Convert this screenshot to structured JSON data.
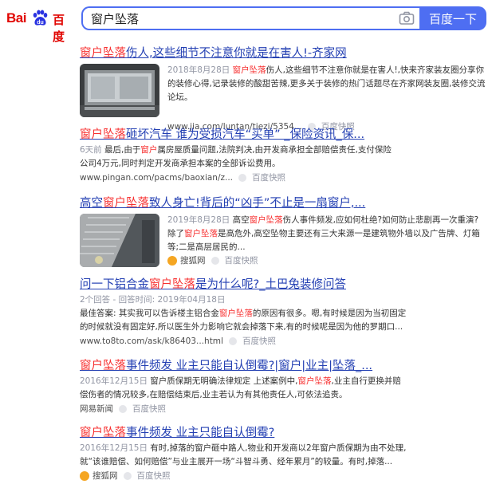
{
  "header": {
    "logo_bai": "Bai",
    "logo_cn": "百度",
    "search_value": "窗户坠落",
    "search_button": "百度一下"
  },
  "results": [
    {
      "title_pre": "",
      "title_hl": "窗户坠落",
      "title_post": "伤人,这些细节不注意你就是在害人!-齐家网",
      "snippet_date": "2018年8月28日",
      "snippet_hl": "窗户坠落",
      "snippet_text": "伤人,这些细节不注意你就是在害人!,快来齐家装友圈分享你的装修心得,记录装修的酸甜苦辣,更多关于装修的热门话题尽在齐家网装友圈,装修交流论坛。",
      "url": "www.jia.com/luntan/tiezi/5354...",
      "snapshot": "百度快照"
    },
    {
      "title_pre": "",
      "title_hl": "窗户坠落",
      "title_post": "砸坏汽车 谁为受损汽车“买单” _保险资讯_保...",
      "snippet_date": "6天前",
      "snippet_a": "最后,由于",
      "snippet_hl1": "窗户",
      "snippet_hl2": "坠落",
      "snippet_b": "属房屋质量问题,法院判决,由开发商承担全部赔偿责任,支付保险公司4万元,同时判定开发商承担本案的全部诉讼费用。",
      "url": "www.pingan.com/pacms/baoxian/z...",
      "snapshot": "百度快照"
    },
    {
      "title_pre": "高空",
      "title_hl": "窗户坠落",
      "title_post": "致人身亡!背后的“凶手”不止是一扇窗户,...",
      "snippet_date": "2019年8月28日",
      "snippet_a": "高空",
      "snippet_hl1": "窗户坠落",
      "snippet_b": "伤人事件频发,应如何杜绝?如何防止悲剧再一次重演? 除了",
      "snippet_hl2": "窗户坠落",
      "snippet_c": "是高危外,高空坠物主要还有三大来源一是建筑物外墙以及广告牌、灯箱等;二是高层居民的...",
      "source": "搜狐网",
      "snapshot": "百度快照"
    },
    {
      "title_pre": "问一下铝合金",
      "title_hl": "窗户坠落",
      "title_post": "是为什么呢?_土巴兔装修问答",
      "meta": "2个回答 - 回答时间: 2019年04月18日",
      "snippet_a": "最佳答案: 其实我可以告诉楼主铝合金",
      "snippet_hl": "窗户坠落",
      "snippet_b": "的原因有很多。嗯,有时候是因为当初固定的时候就没有固定好,所以医生外力影响它就会掉落下来,有的时候呢是因为他的罗期口...",
      "url": "www.to8to.com/ask/k86403...html",
      "snapshot": "百度快照"
    },
    {
      "title_pre": "",
      "title_hl": "窗户坠落",
      "title_post": "事件频发 业主只能自认倒霉?|窗户|业主|坠落_...",
      "snippet_date": "2016年12月15日",
      "snippet_a": "窗户质保期无明确法律规定 上述案例中,",
      "snippet_hl": "窗户坠落",
      "snippet_b": ",业主自行更换并赔偿伤者的情况较多,在赔偿结束后,业主若认为有其他责任人,可依法追责。",
      "source": "网易新闻",
      "snapshot": "百度快照"
    },
    {
      "title_pre": "",
      "title_hl": "窗户坠落",
      "title_post": "事件频发 业主只能自认倒霉?",
      "snippet_date": "2016年12月15日",
      "snippet_text": "有时,掉落的窗户砸中路人,物业和开发商以2年窗户质保期为由不处理,就“该谁赔偿、如何赔偿”与业主展开一场“斗智斗勇、经年累月”的较量。有时,掉落...",
      "source": "搜狐网",
      "snapshot": "百度快照"
    }
  ],
  "colors": {
    "brand_red": "#e10602",
    "accent_blue": "#4e6ef2",
    "link": "#2440b3",
    "highlight": "#f73131"
  }
}
